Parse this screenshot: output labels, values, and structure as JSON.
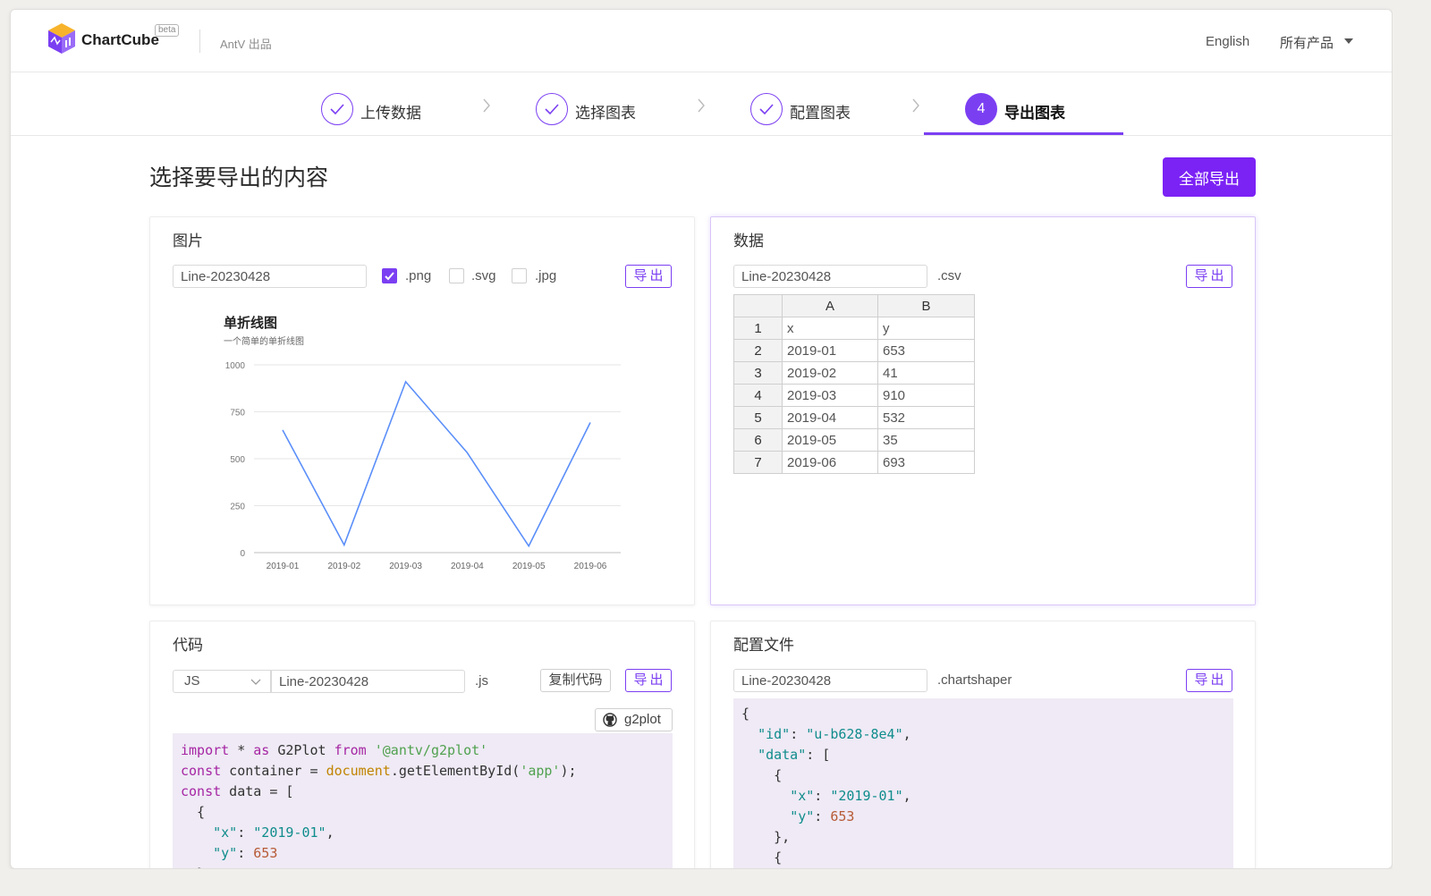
{
  "header": {
    "brand": "ChartCube",
    "beta": "beta",
    "by": "AntV 出品",
    "language": "English",
    "products": "所有产品"
  },
  "steps": [
    {
      "label": "上传数据",
      "state": "done"
    },
    {
      "label": "选择图表",
      "state": "done"
    },
    {
      "label": "配置图表",
      "state": "done"
    },
    {
      "label": "导出图表",
      "number": "4",
      "state": "active"
    }
  ],
  "page": {
    "title": "选择要导出的内容",
    "export_all": "全部导出"
  },
  "image_card": {
    "title": "图片",
    "filename": "Line-20230428",
    "formats": [
      {
        "label": ".png",
        "checked": true
      },
      {
        "label": ".svg",
        "checked": false
      },
      {
        "label": ".jpg",
        "checked": false
      }
    ],
    "export": "导出"
  },
  "chart_data": {
    "type": "line",
    "title": "单折线图",
    "subtitle": "一个简单的单折线图",
    "categories": [
      "2019-01",
      "2019-02",
      "2019-03",
      "2019-04",
      "2019-05",
      "2019-06"
    ],
    "values": [
      653,
      41,
      910,
      532,
      35,
      693
    ],
    "yticks": [
      "0",
      "250",
      "500",
      "750",
      "1000"
    ],
    "ylim": [
      0,
      1000
    ],
    "grid": true,
    "color": "#5b8ff9"
  },
  "data_card": {
    "title": "数据",
    "filename": "Line-20230428",
    "suffix": ".csv",
    "export": "导出",
    "columns": [
      "A",
      "B"
    ],
    "rows": [
      [
        "1",
        "x",
        "y"
      ],
      [
        "2",
        "2019-01",
        "653"
      ],
      [
        "3",
        "2019-02",
        "41"
      ],
      [
        "4",
        "2019-03",
        "910"
      ],
      [
        "5",
        "2019-04",
        "532"
      ],
      [
        "6",
        "2019-05",
        "35"
      ],
      [
        "7",
        "2019-06",
        "693"
      ]
    ]
  },
  "code_card": {
    "title": "代码",
    "language": "JS",
    "filename": "Line-20230428",
    "suffix": ".js",
    "copy": "复制代码",
    "export": "导出",
    "github": "g2plot",
    "lines": [
      "import * as G2Plot from '@antv/g2plot'",
      "const container = document.getElementById('app');",
      "const data = [",
      "  {",
      "    \"x\": \"2019-01\",",
      "    \"y\": 653",
      "  },"
    ]
  },
  "config_card": {
    "title": "配置文件",
    "filename": "Line-20230428",
    "suffix": ".chartshaper",
    "export": "导出",
    "lines": [
      "{",
      "  \"id\": \"u-b628-8e4\",",
      "  \"data\": [",
      "    {",
      "      \"x\": \"2019-01\",",
      "      \"y\": 653",
      "    },",
      "    {"
    ]
  },
  "colors": {
    "accent": "#7b3ff2",
    "button": "#7b22f5",
    "code_bg": "#efeaf5"
  }
}
